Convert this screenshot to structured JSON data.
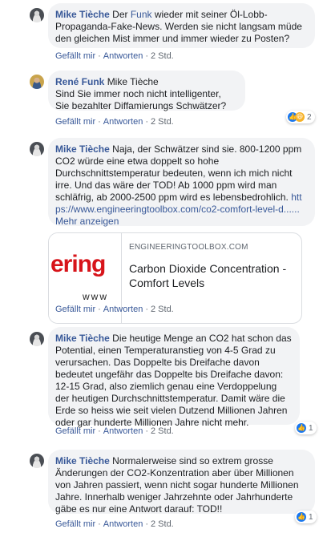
{
  "comments": [
    {
      "author": "Mike Tièche",
      "text_before_tag": " Der ",
      "tag": "Funk",
      "text_after_tag": " wieder mit seiner Öl-Lobb-Propaganda-Fake-News. Werden sie nicht langsam müde den gleichen Mist immer und immer wieder zu Posten?",
      "like": "Gefällt mir",
      "reply": "Antworten",
      "time": "2 Std."
    },
    {
      "author": "René Funk",
      "tag": "Mike Tièche",
      "text": "Sind Sie immer noch nicht intelligenter, Sie bezahlter Diffamierungs Schwätzer?",
      "like": "Gefällt mir",
      "reply": "Antworten",
      "time": "2 Std.",
      "reaction_count": "2"
    },
    {
      "author": "Mike Tièche",
      "text": " Naja, der Schwätzer sind sie. 800-1200 ppm CO2 würde eine etwa doppelt so hohe Durchschnittstemperatur bedeuten, wenn ich mich nicht irre. Und das wäre der TOD! Ab 1000 ppm wird man schläfrig, ab 2000-2500 ppm wird es lebensbedrohlich.",
      "link": "https://www.engineeringtoolbox.com/co2-comfort-level-d......",
      "more": "Mehr anzeigen",
      "preview": {
        "thumb_text": "ering",
        "thumb_www": "www",
        "domain": "ENGINEERINGTOOLBOX.COM",
        "title": "Carbon Dioxide Concentration - Comfort Levels"
      },
      "like": "Gefällt mir",
      "reply": "Antworten",
      "time": "2 Std."
    },
    {
      "author": "Mike Tièche",
      "text": " Die heutige Menge an CO2 hat schon das Potential, einen Temperaturanstieg von 4-5 Grad zu verursachen. Das Doppelte bis Dreifache davon bedeutet ungefähr das Doppelte bis Dreifache davon: 12-15 Grad, also ziemlich genau eine Verdoppelung der heutigen Durchschnittstemperatur. Damit wäre die Erde so heiss wie seit vielen Dutzend Millionen Jahren oder gar hunderte Millionen Jahre nicht mehr.",
      "like": "Gefällt mir",
      "reply": "Antworten",
      "time": "2 Std.",
      "reaction_count": "1"
    },
    {
      "author": "Mike Tièche",
      "text": " Normalerweise sind so extrem grosse Änderungen der CO2-Konzentration aber über Millionen von Jahren passiert, wenn nicht sogar hunderte Millionen Jahre. Innerhalb weniger Jahrzehnte oder Jahrhunderte gäbe es nur eine Antwort darauf: TOD!!",
      "like": "Gefällt mir",
      "reply": "Antworten",
      "time": "2 Std.",
      "reaction_count": "1"
    }
  ],
  "colors": {
    "link": "#385898",
    "bubble": "#f2f3f5",
    "like_blue": "#1877f2",
    "haha_yellow": "#f7b125",
    "brand_red": "#d7141a"
  }
}
